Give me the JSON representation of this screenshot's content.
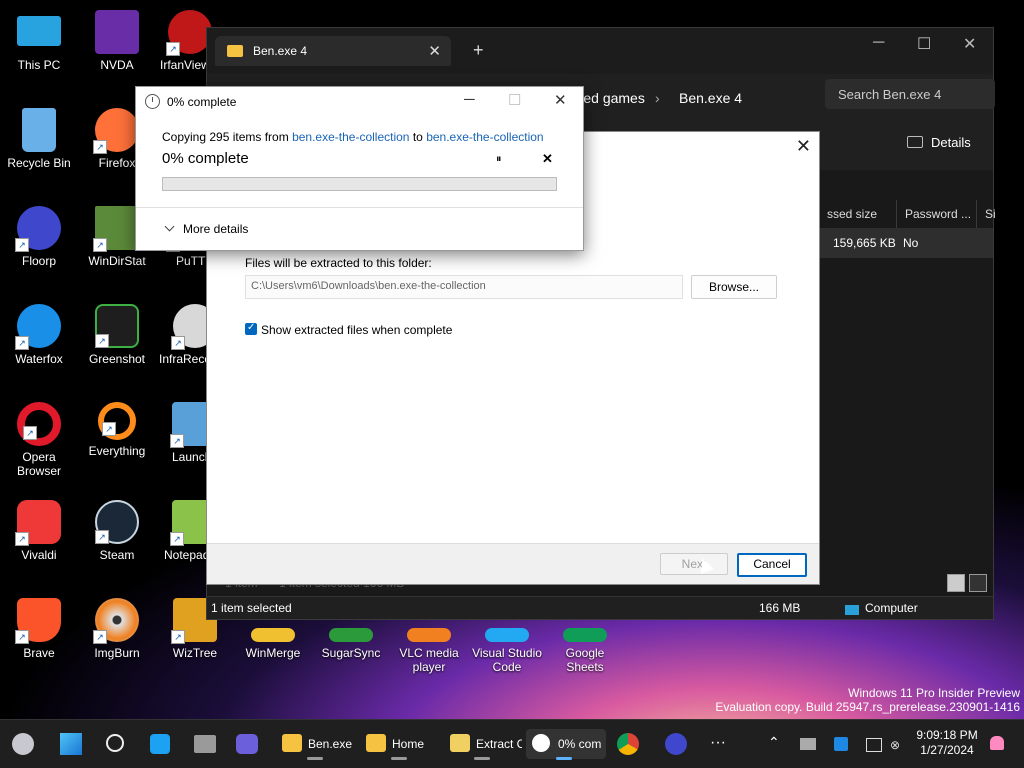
{
  "desktop": {
    "icons": [
      {
        "label": "This PC",
        "color": "#29a3e0"
      },
      {
        "label": "Recycle Bin",
        "color": "#6ab0e8"
      },
      {
        "label": "Floorp",
        "color": "#3f47cc"
      },
      {
        "label": "Waterfox",
        "color": "#1a8fe8"
      },
      {
        "label": "Opera Browser",
        "color": "#e11a2b"
      },
      {
        "label": "Vivaldi",
        "color": "#ef3939"
      },
      {
        "label": "Brave",
        "color": "#fb542b"
      },
      {
        "label": "NVDA",
        "color": "#6a2da8"
      },
      {
        "label": "Firefox",
        "color": "#ff7139"
      },
      {
        "label": "WinDirStat",
        "color": "#5b8a3a"
      },
      {
        "label": "Greenshot",
        "color": "#3cb043"
      },
      {
        "label": "Everything",
        "color": "#ff8c1a"
      },
      {
        "label": "Steam",
        "color": "#1b2838"
      },
      {
        "label": "ImgBurn",
        "color": "#c0c0c0"
      },
      {
        "label": "IrfanView",
        "color": "#c01818"
      },
      {
        "label": "PuTTY",
        "color": "#bcbcbc"
      },
      {
        "label": "InfraRecorder",
        "color": "#d8d8d8"
      },
      {
        "label": "Launch",
        "color": "#5aa0d8"
      },
      {
        "label": "Notepad",
        "color": "#8bc34a"
      },
      {
        "label": "WizTree",
        "color": "#e0a020"
      },
      {
        "label": "WinMerge",
        "color": "#f0c030"
      },
      {
        "label": "SugarSync",
        "color": "#2b9a3a"
      },
      {
        "label": "VLC media player",
        "color": "#f08020"
      },
      {
        "label": "Visual Studio Code",
        "color": "#23a9f2"
      },
      {
        "label": "Google Sheets",
        "color": "#0f9d58"
      }
    ]
  },
  "explorer": {
    "tab_title": "Ben.exe 4",
    "new_tab": "+",
    "breadcrumb": {
      "parent": "Outlasted games",
      "current": "Ben.exe 4",
      "sep": "›"
    },
    "search_placeholder": "Search Ben.exe 4",
    "details_button": "Details",
    "columns": {
      "compressed_size": "ssed size",
      "password": "Password ...",
      "size": "Si"
    },
    "row": {
      "compressed_size": "159,665 KB",
      "password": "No"
    },
    "status": {
      "selected": "1 item selected",
      "size": "166 MB",
      "location": "Computer"
    },
    "obscured_status": {
      "count": "1 item",
      "selected": "1 item selected 166 MB"
    },
    "controls": {
      "minimize": "─",
      "maximize": "☐",
      "close": "✕"
    }
  },
  "wizard": {
    "close": "✕",
    "folder_label": "Files will be extracted to this folder:",
    "folder_path": "C:\\Users\\vm6\\Downloads\\ben.exe-the-collection",
    "browse": "Browse...",
    "show_files_label": "Show extracted files when complete",
    "show_files_checked": true,
    "next": "Next",
    "cancel": "Cancel"
  },
  "progress_dialog": {
    "title": "0% complete",
    "copying_prefix": "Copying 295 items from",
    "source": "ben.exe-the-collection",
    "to": "to",
    "destination": "ben.exe-the-collection",
    "percent_text": "0% complete",
    "percent": 0,
    "pause": "⏸",
    "stop": "✕",
    "more_details": "More details",
    "controls": {
      "minimize": "─",
      "maximize": "☐",
      "close": "✕"
    }
  },
  "taskbar": {
    "apps": [
      {
        "label": "Ben.exe",
        "color": "#f5c242"
      },
      {
        "label": "Home",
        "color": "#f5c242"
      },
      {
        "label": "Extract C",
        "color": "#f0d060"
      },
      {
        "label": "0% com",
        "color": "#ffffff"
      }
    ],
    "more": "···",
    "tray_up": "⌃",
    "time": "9:09:18 PM",
    "date": "1/27/2024"
  },
  "watermark": {
    "line1": "Windows 11 Pro Insider Preview",
    "line2": "Evaluation copy. Build 25947.rs_prerelease.230901-1416"
  }
}
